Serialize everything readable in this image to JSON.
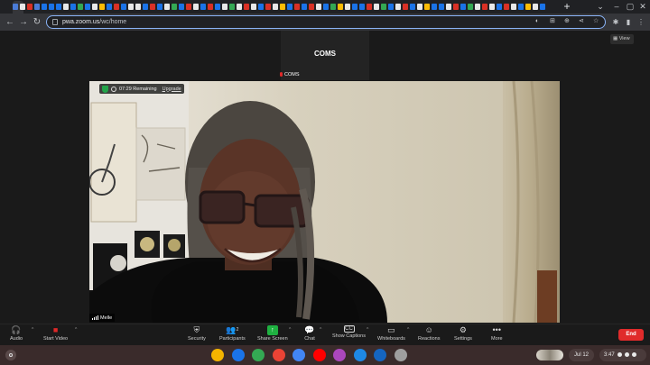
{
  "browser": {
    "tab_favicon_colors": [
      "#4a7bd6",
      "#e8e8e8",
      "#d93025",
      "#4a7bd6",
      "#1a73e8",
      "#1a73e8",
      "#1a73e8",
      "#e8e8e8",
      "#1a73e8",
      "#34a853",
      "#1a73e8",
      "#e8e8e8",
      "#fbbc05",
      "#1a73e8",
      "#d93025",
      "#1a73e8",
      "#e8e8e8",
      "#e8e8e8",
      "#1a73e8",
      "#d93025",
      "#1a73e8",
      "#e8e8e8",
      "#34a853",
      "#1a73e8",
      "#d93025",
      "#e8e8e8",
      "#1a73e8",
      "#d93025",
      "#1a73e8",
      "#e8e8e8",
      "#34a853",
      "#e8e8e8",
      "#d93025",
      "#e8e8e8",
      "#1a73e8",
      "#d93025",
      "#e8e8e8",
      "#fbbc05",
      "#1a73e8",
      "#d93025",
      "#1a73e8",
      "#d93025",
      "#e8e8e8",
      "#1a73e8",
      "#34a853",
      "#fbbc05",
      "#e8e8e8",
      "#1a73e8",
      "#1a73e8",
      "#d93025",
      "#e8e8e8",
      "#34a853",
      "#1a73e8",
      "#e8e8e8",
      "#d93025",
      "#1a73e8",
      "#e8e8e8",
      "#fbbc05",
      "#1a73e8",
      "#1a73e8",
      "#e8e8e8",
      "#d93025",
      "#1a73e8",
      "#34a853",
      "#e8e8e8",
      "#d93025",
      "#e8e8e8",
      "#1a73e8",
      "#d93025",
      "#e8e8e8",
      "#1a73e8",
      "#fbbc05",
      "#e8e8e8",
      "#1a73e8"
    ],
    "new_tab_label": "+",
    "url_domain": "pwa.zoom.us",
    "url_path": "/wc/home"
  },
  "meeting": {
    "top_tile_name": "COMS",
    "speaker_label": "COMS",
    "view_label": "View",
    "timer_text": "07:29 Remaining",
    "upgrade_label": "Upgrade",
    "participant_name": "Melle",
    "participants_count": "2"
  },
  "controls": {
    "audio": "Audio",
    "start_video": "Start Video",
    "security": "Security",
    "participants": "Participants",
    "share_screen": "Share Screen",
    "chat": "Chat",
    "show_captions": "Show Captions",
    "whiteboards": "Whiteboards",
    "reactions": "Reactions",
    "settings": "Settings",
    "more": "More",
    "end": "End",
    "share_color": "#1fb141",
    "end_color": "#e02b2b"
  },
  "shelf": {
    "app_colors": [
      "#f4b400",
      "#1a73e8",
      "#34a853",
      "#ea4335",
      "#4285f4",
      "#ff0000",
      "#ab47bc",
      "#1e88e5",
      "#1565c0",
      "#9e9e9e"
    ],
    "app_icons": [
      "chrome-icon",
      "gmail-like-icon",
      "meet-icon",
      "gmail-icon",
      "docs-icon",
      "youtube-icon",
      "app-icon",
      "messages-icon",
      "files-icon",
      "settings-icon"
    ],
    "date": "Jul 12",
    "time": "3:47"
  }
}
